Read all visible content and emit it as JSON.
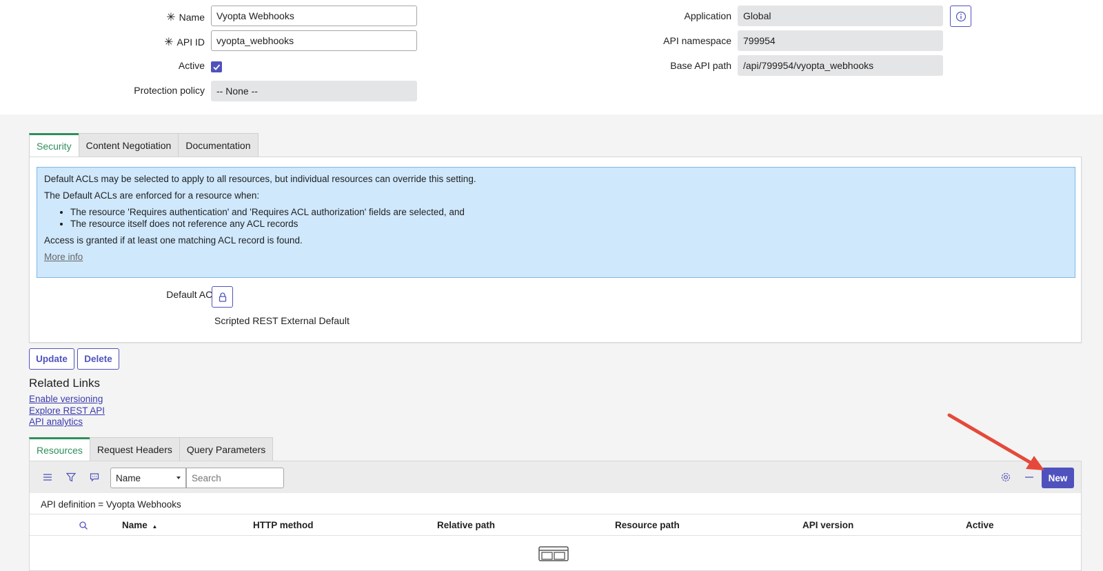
{
  "form": {
    "name_label": "Name",
    "name_value": "Vyopta Webhooks",
    "api_id_label": "API ID",
    "api_id_value": "vyopta_webhooks",
    "active_label": "Active",
    "active_checked": true,
    "protection_label": "Protection policy",
    "protection_value": "-- None --",
    "application_label": "Application",
    "application_value": "Global",
    "namespace_label": "API namespace",
    "namespace_value": "799954",
    "base_path_label": "Base API path",
    "base_path_value": "/api/799954/vyopta_webhooks",
    "required_marker": "✳"
  },
  "section_tabs": [
    {
      "label": "Security",
      "active": true
    },
    {
      "label": "Content Negotiation",
      "active": false
    },
    {
      "label": "Documentation",
      "active": false
    }
  ],
  "security": {
    "notice_line1": "Default ACLs may be selected to apply to all resources, but individual resources can override this setting.",
    "notice_line2": "The Default ACLs are enforced for a resource when:",
    "bullets": [
      "The resource 'Requires authentication' and 'Requires ACL authorization' fields are selected, and",
      "The resource itself does not reference any ACL records"
    ],
    "notice_line3": "Access is granted if at least one matching ACL record is found.",
    "more_info": "More info",
    "default_acls_label": "Default ACLs",
    "default_acls_value": "Scripted REST External Default"
  },
  "actions": {
    "update": "Update",
    "delete": "Delete"
  },
  "related": {
    "title": "Related Links",
    "links": [
      "Enable versioning",
      "Explore REST API",
      "API analytics"
    ]
  },
  "list_tabs": [
    {
      "label": "Resources",
      "active": true
    },
    {
      "label": "Request Headers",
      "active": false
    },
    {
      "label": "Query Parameters",
      "active": false
    }
  ],
  "list": {
    "field_select": "Name",
    "search_placeholder": "Search",
    "new_button": "New",
    "breadcrumb": "API definition = Vyopta Webhooks",
    "columns": [
      "Name",
      "HTTP method",
      "Relative path",
      "Resource path",
      "API version",
      "Active"
    ],
    "sort_indicator": "▲"
  },
  "colors": {
    "accent": "#4f52bd",
    "active_tab": "#2e8e5a",
    "notice_bg": "#cfe8fc",
    "annotation_arrow": "#e5493a"
  }
}
